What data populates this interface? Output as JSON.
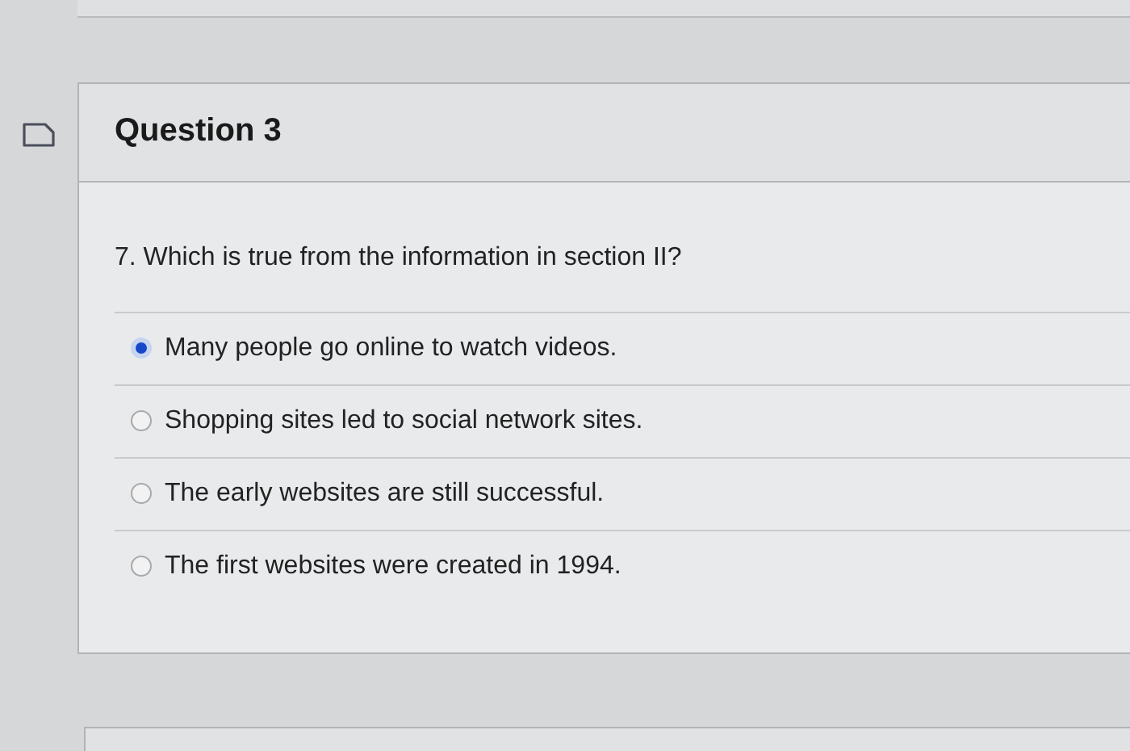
{
  "question": {
    "title": "Question 3",
    "prompt": "7. Which is true from the information in section II?",
    "options": [
      {
        "label": "Many people go online to watch videos.",
        "selected": true
      },
      {
        "label": "Shopping sites led to social network sites.",
        "selected": false
      },
      {
        "label": "The early websites are still successful.",
        "selected": false
      },
      {
        "label": "The first websites were created in 1994.",
        "selected": false
      }
    ]
  }
}
